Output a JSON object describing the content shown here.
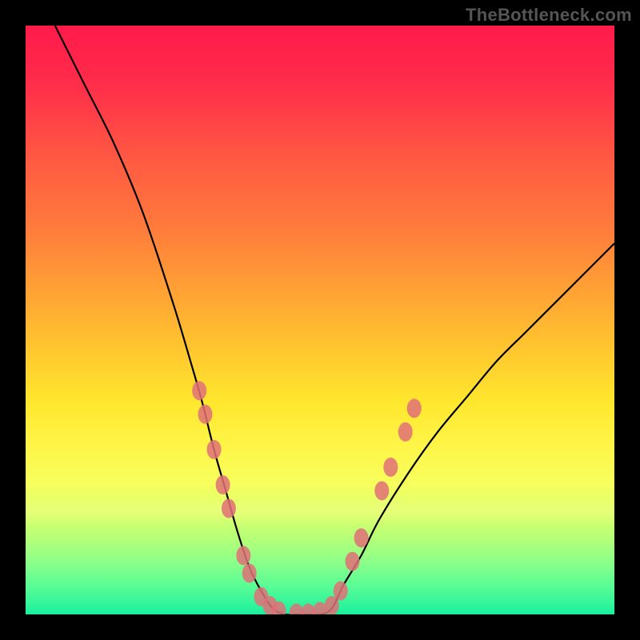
{
  "watermark": "TheBottleneck.com",
  "chart_data": {
    "type": "line",
    "title": "",
    "xlabel": "",
    "ylabel": "",
    "xlim": [
      0,
      100
    ],
    "ylim": [
      0,
      100
    ],
    "series": [
      {
        "name": "bottleneck-curve",
        "x": [
          5,
          10,
          15,
          20,
          25,
          28,
          30,
          32,
          34,
          36,
          38,
          40,
          42,
          44,
          46,
          48,
          50,
          52,
          54,
          57,
          60,
          65,
          70,
          75,
          80,
          85,
          90,
          95,
          100
        ],
        "y": [
          100,
          90,
          80,
          68,
          53,
          43,
          36,
          28,
          21,
          14,
          8,
          4,
          1,
          0,
          0,
          0,
          0,
          1,
          5,
          10,
          16,
          24,
          31,
          37,
          43,
          48,
          53,
          58,
          63
        ]
      }
    ],
    "markers": {
      "name": "highlighted-points",
      "color": "#e07078",
      "points": [
        {
          "x": 29.5,
          "y": 38
        },
        {
          "x": 30.5,
          "y": 34
        },
        {
          "x": 32.0,
          "y": 28
        },
        {
          "x": 33.5,
          "y": 22
        },
        {
          "x": 34.5,
          "y": 18
        },
        {
          "x": 37.0,
          "y": 10
        },
        {
          "x": 38.0,
          "y": 7
        },
        {
          "x": 40.0,
          "y": 3
        },
        {
          "x": 41.5,
          "y": 1.5
        },
        {
          "x": 43.0,
          "y": 0.6
        },
        {
          "x": 46.0,
          "y": 0.2
        },
        {
          "x": 48.0,
          "y": 0.2
        },
        {
          "x": 50.0,
          "y": 0.5
        },
        {
          "x": 52.0,
          "y": 1.5
        },
        {
          "x": 53.5,
          "y": 4
        },
        {
          "x": 55.5,
          "y": 9
        },
        {
          "x": 57.0,
          "y": 13
        },
        {
          "x": 60.5,
          "y": 21
        },
        {
          "x": 62.0,
          "y": 25
        },
        {
          "x": 64.5,
          "y": 31
        },
        {
          "x": 66.0,
          "y": 35
        }
      ]
    }
  }
}
